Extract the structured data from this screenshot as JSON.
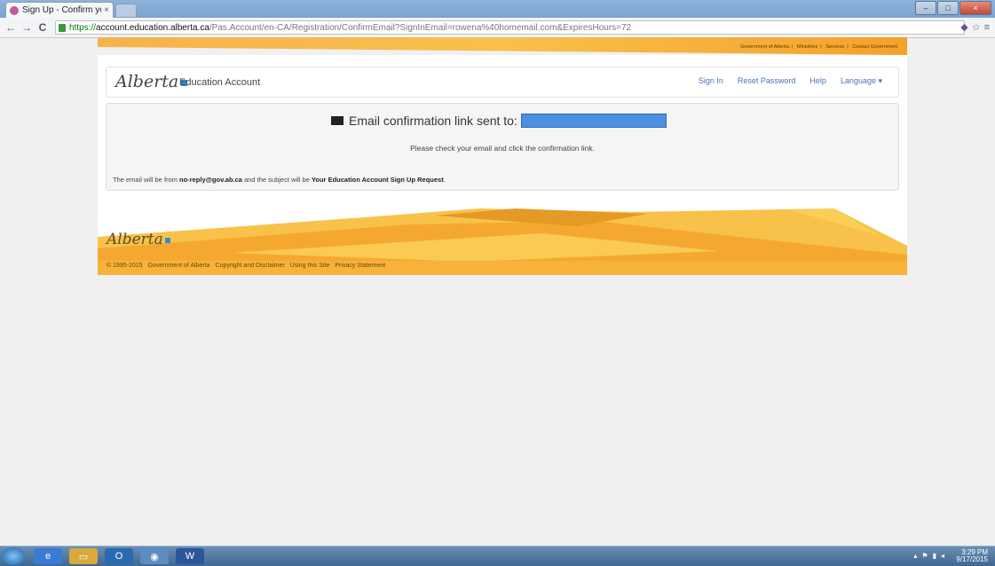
{
  "browser": {
    "tab_title": "Sign Up - Confirm your e",
    "tab_close": "×",
    "url_scheme": "https://",
    "url_host": "account.education.alberta.ca",
    "url_path": "/Pas.Account/en-CA/Registration/ConfirmEmail?SignInEmail=rowena%40homemail.com&ExpiresHours=72",
    "back_icon": "←",
    "forward_icon": "→",
    "reload_icon": "C",
    "star_icon": "☆",
    "menu_icon": "≡"
  },
  "gov_links": [
    "Government of Alberta",
    "Ministries",
    "Services",
    "Contact Government"
  ],
  "header": {
    "logo_text": "Alberta",
    "brand": "Education Account",
    "nav": [
      "Sign In",
      "Reset Password",
      "Help",
      "Language ▾"
    ]
  },
  "panel": {
    "heading": "Email confirmation link sent to:",
    "instructions": "Please check your email and click the confirmation link.",
    "note_prefix": "The email will be from ",
    "note_sender": "no-reply@gov.ab.ca",
    "note_middle": " and the subject will be ",
    "note_subject": "Your Education Account Sign Up Request",
    "note_end": "."
  },
  "footer": {
    "logo_text": "Alberta",
    "copyright": "© 1995-2015",
    "links": [
      "Government of Alberta",
      "Copyright and Disclaimer",
      "Using this Site",
      "Privacy Statement"
    ]
  },
  "taskbar": {
    "time": "3:29 PM",
    "date": "9/17/2015"
  },
  "colors": {
    "accent_orange": "#f7b24b",
    "link_blue": "#4a74b8",
    "redacted_box": "#4d8fe0"
  }
}
